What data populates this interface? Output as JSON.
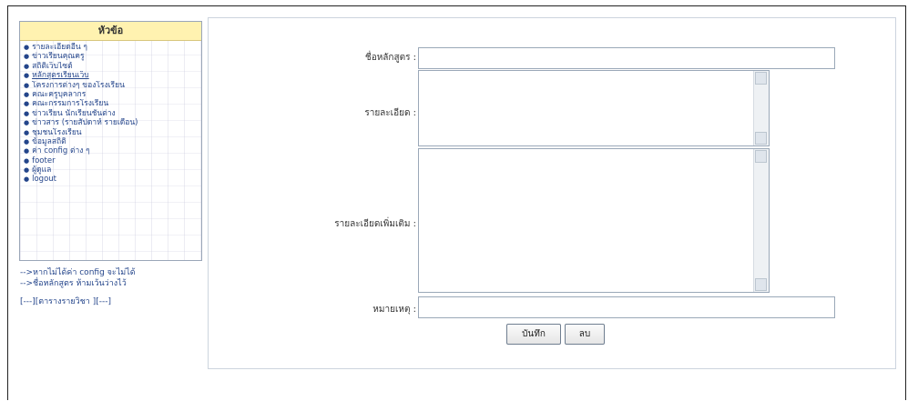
{
  "sidebar": {
    "title": "หัวข้อ",
    "items": [
      {
        "label": "รายละเอียดอื่น ๆ"
      },
      {
        "label": "ข่าวเรียนคุณครู"
      },
      {
        "label": "สถิติเว็บไซต์"
      },
      {
        "label": "หลักสูตรเรียนเว็บ",
        "active": true
      },
      {
        "label": "โครงการต่างๆ ของโรงเรียน"
      },
      {
        "label": "คณะครูบุคลากร"
      },
      {
        "label": "คณะกรรมการโรงเรียน"
      },
      {
        "label": "ข่าวเรียน นักเรียนชั้นต่าง"
      },
      {
        "label": "ข่าวสาร (รายสัปดาห์ รายเดือน)"
      },
      {
        "label": "ชุมชนโรงเรียน"
      },
      {
        "label": "ข้อมูลสถิติ"
      },
      {
        "label": "ค่า config ต่าง ๆ"
      },
      {
        "label": "footer"
      },
      {
        "label": "ผู้ดูแล"
      },
      {
        "label": "logout"
      }
    ],
    "notes": [
      "-->หากไม่ได้ค่า config จะไม่ได้",
      "-->ชื่อหลักสูตร ห้ามเว้นว่างไว้"
    ],
    "breadcrumb": "[---][ตารางรายวิชา ][---]"
  },
  "form": {
    "course_name_label": "ชื่อหลักสูตร :",
    "detail_label": "รายละเอียด :",
    "more_detail_label": "รายละเอียดเพิ่มเติม :",
    "note_label": "หมายเหตุ :",
    "course_name_value": "",
    "detail_value": "",
    "more_detail_value": "",
    "note_value": "",
    "save_label": "บันทึก",
    "delete_label": "ลบ"
  }
}
